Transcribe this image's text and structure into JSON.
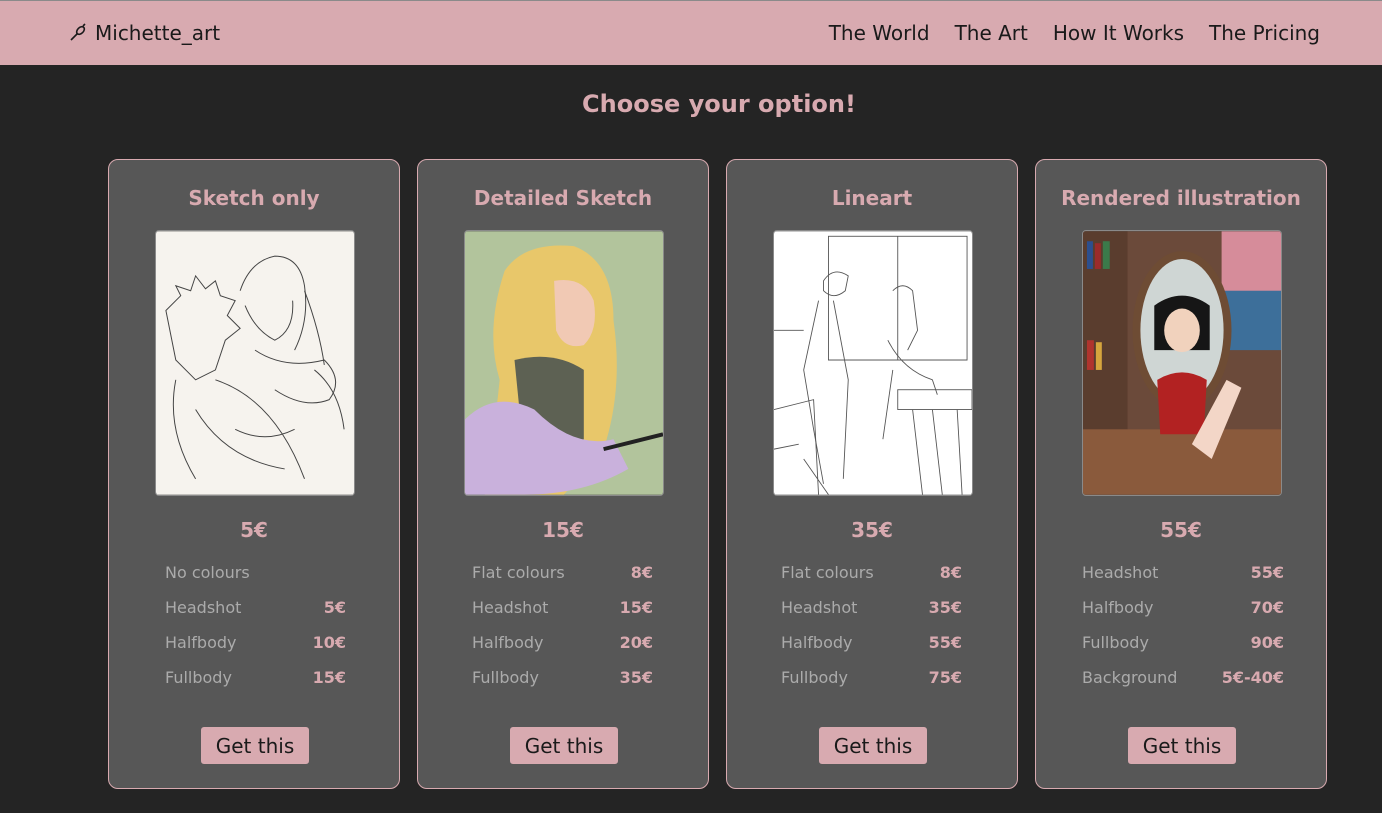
{
  "header": {
    "brand": "Michette_art",
    "nav": [
      "The World",
      "The Art",
      "How It Works",
      "The Pricing"
    ]
  },
  "page": {
    "heading": "Choose your option!"
  },
  "cards": [
    {
      "title": "Sketch only",
      "price": "5€",
      "options": [
        {
          "label": "No colours",
          "value": ""
        },
        {
          "label": "Headshot",
          "value": "5€"
        },
        {
          "label": "Halfbody",
          "value": "10€"
        },
        {
          "label": "Fullbody",
          "value": "15€"
        }
      ],
      "button": "Get this"
    },
    {
      "title": "Detailed Sketch",
      "price": "15€",
      "options": [
        {
          "label": "Flat colours",
          "value": "8€"
        },
        {
          "label": "Headshot",
          "value": "15€"
        },
        {
          "label": "Halfbody",
          "value": "20€"
        },
        {
          "label": "Fullbody",
          "value": "35€"
        }
      ],
      "button": "Get this"
    },
    {
      "title": "Lineart",
      "price": "35€",
      "options": [
        {
          "label": "Flat colours",
          "value": "8€"
        },
        {
          "label": "Headshot",
          "value": "35€"
        },
        {
          "label": "Halfbody",
          "value": "55€"
        },
        {
          "label": "Fullbody",
          "value": "75€"
        }
      ],
      "button": "Get this"
    },
    {
      "title": "Rendered illustration",
      "price": "55€",
      "options": [
        {
          "label": "Headshot",
          "value": "55€"
        },
        {
          "label": "Halfbody",
          "value": "70€"
        },
        {
          "label": "Fullbody",
          "value": "90€"
        },
        {
          "label": "Background",
          "value": "5€-40€"
        }
      ],
      "button": "Get this"
    }
  ],
  "colors": {
    "accent": "#d8aab0",
    "background": "#242424",
    "card": "#575757"
  },
  "icons": {
    "brand": "brush-icon"
  }
}
